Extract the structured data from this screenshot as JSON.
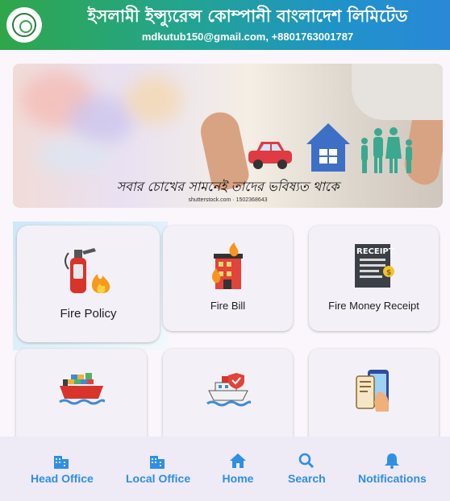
{
  "header": {
    "title": "ইসলামী ইন্স্যুরেন্স কোম্পানী বাংলাদেশ লিমিটেড",
    "contact": "mdkutub150@gmail.com, +8801763001787",
    "logo_icon": "company-logo-icon"
  },
  "banner": {
    "caption": "সবার চোখের সামনেই তাদের ভবিষ্যত থাকে",
    "credit": "shutterstock.com · 1502368643"
  },
  "grid": {
    "items": [
      {
        "label": "Fire Policy",
        "icon": "fire-extinguisher-icon",
        "selected": true
      },
      {
        "label": "Fire Bill",
        "icon": "burning-building-icon"
      },
      {
        "label": "Fire Money Receipt",
        "icon": "receipt-icon",
        "icon_text": "RECEIPT"
      },
      {
        "label": "",
        "icon": "cargo-ship-icon"
      },
      {
        "label": "",
        "icon": "insured-ship-icon"
      },
      {
        "label": "",
        "icon": "mobile-document-icon"
      }
    ]
  },
  "bottom_nav": {
    "items": [
      {
        "label": "Head Office",
        "icon": "building-icon"
      },
      {
        "label": "Local Office",
        "icon": "building-icon"
      },
      {
        "label": "Home",
        "icon": "home-icon"
      },
      {
        "label": "Search",
        "icon": "search-icon"
      },
      {
        "label": "Notifications",
        "icon": "bell-icon"
      }
    ]
  },
  "colors": {
    "header_gradient_start": "#2fa64a",
    "header_gradient_end": "#2a88d8",
    "nav_accent": "#2f8fe3",
    "card_bg": "#f4f0f7",
    "page_bg": "#faf6fc"
  }
}
